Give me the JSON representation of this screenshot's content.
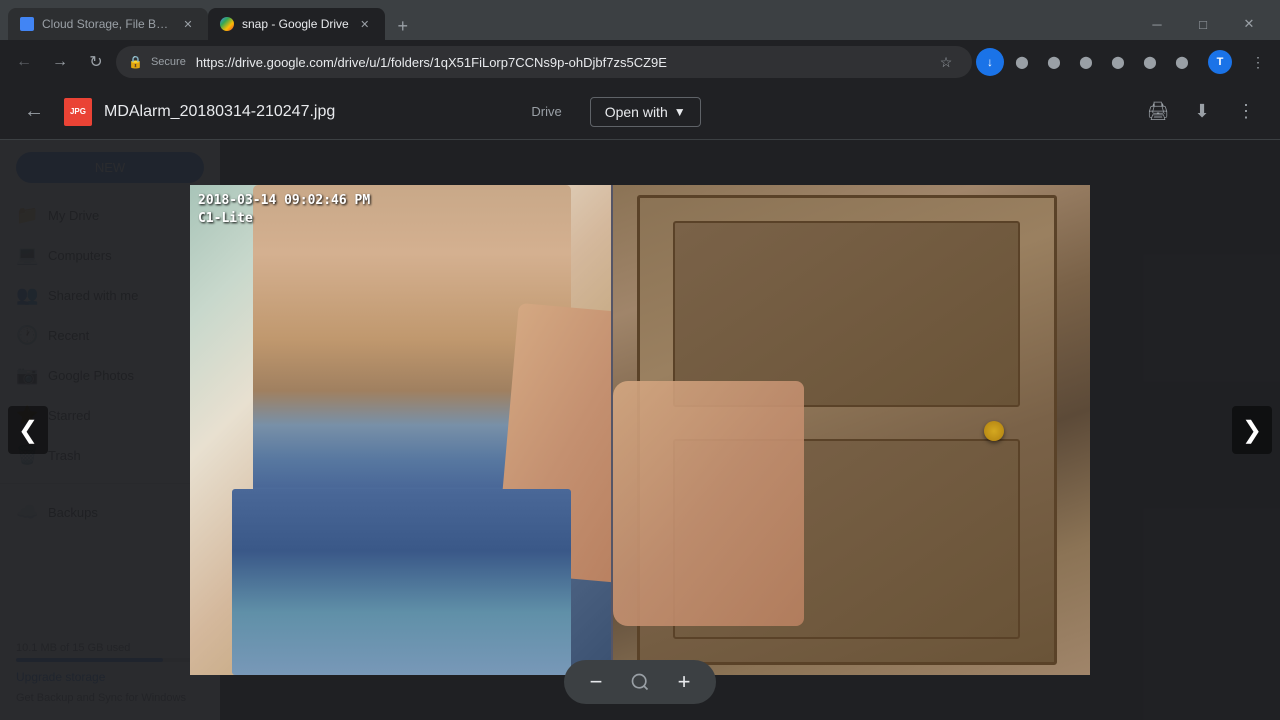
{
  "browser": {
    "tabs": [
      {
        "id": "tab1",
        "label": "Cloud Storage, File Back...",
        "favicon_color": "#4285f4",
        "active": false
      },
      {
        "id": "tab2",
        "label": "snap - Google Drive",
        "favicon_color": "#fbbc04",
        "active": true
      }
    ],
    "url": "https://drive.google.com/drive/u/1/folders/1qX51FiLorp7CCNs9p-ohDjbf7zs5CZ9E",
    "secure_label": "Secure",
    "new_tab_icon": "+",
    "window_controls": {
      "minimize": "─",
      "maximize": "□",
      "close": "✕"
    }
  },
  "drive": {
    "logo_text": "Drive",
    "new_button": "NEW",
    "nav_items": [
      {
        "id": "my-drive",
        "label": "My Drive",
        "icon": "📁"
      },
      {
        "id": "computers",
        "label": "Computers",
        "icon": "💻"
      },
      {
        "id": "shared",
        "label": "Shared with me",
        "icon": "👥"
      },
      {
        "id": "recent",
        "label": "Recent",
        "icon": "🕐"
      },
      {
        "id": "photos",
        "label": "Google Photos",
        "icon": "⭐"
      },
      {
        "id": "starred",
        "label": "Starred",
        "icon": "⭐"
      },
      {
        "id": "trash",
        "label": "Trash",
        "icon": "🗑️"
      },
      {
        "id": "backups",
        "label": "Backups",
        "icon": "☁️"
      }
    ],
    "storage": {
      "used": "10.1 MB of 15 GB used",
      "percent": 78,
      "upgrade": "Upgrade storage"
    },
    "footer": "Get Backup and Sync for Windows"
  },
  "viewer": {
    "filename": "MDAlarm_20180314-210247.jpg",
    "back_icon": "←",
    "open_with_label": "Open with",
    "breadcrumb": "Drive",
    "toolbar": {
      "print_icon": "🖨",
      "download_icon": "⬇",
      "more_icon": "⋮"
    }
  },
  "image": {
    "timestamp": "2018-03-14 09:02:46 PM",
    "camera_label": "C1-Lite"
  },
  "zoom": {
    "minus": "−",
    "zoom_icon": "🔍",
    "plus": "+"
  },
  "nav_arrows": {
    "left": "❮",
    "right": "❯"
  }
}
